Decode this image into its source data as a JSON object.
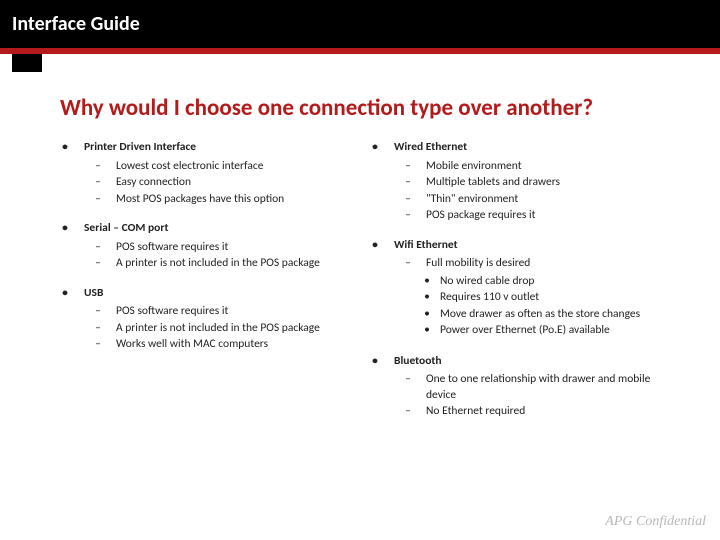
{
  "titlebar": "Interface Guide",
  "heading": "Why would I choose one connection type over another?",
  "left": [
    {
      "title": "Printer Driven Interface",
      "points": [
        "Lowest cost electronic interface",
        "Easy connection",
        "Most POS packages have this option"
      ]
    },
    {
      "title": "Serial – COM port",
      "points": [
        "POS software requires it",
        "A printer is not included in the POS package"
      ]
    },
    {
      "title": "USB",
      "points": [
        "POS software requires it",
        "A printer is not included in the POS package",
        "Works well with MAC computers"
      ]
    }
  ],
  "right": [
    {
      "title": "Wired Ethernet",
      "points": [
        "Mobile environment",
        "Multiple tablets and drawers",
        "\"Thin\" environment",
        "POS package requires it"
      ]
    },
    {
      "title": "Wifi Ethernet",
      "points": [
        {
          "text": "Full mobility is desired",
          "sub": [
            "No wired cable drop",
            "Requires 110 v outlet",
            "Move drawer as often as the store changes",
            "Power over Ethernet (Po.E) available"
          ]
        }
      ]
    },
    {
      "title": "Bluetooth",
      "points": [
        "One to one relationship with drawer and mobile device",
        "No Ethernet required"
      ]
    }
  ],
  "footer": "APG Confidential"
}
